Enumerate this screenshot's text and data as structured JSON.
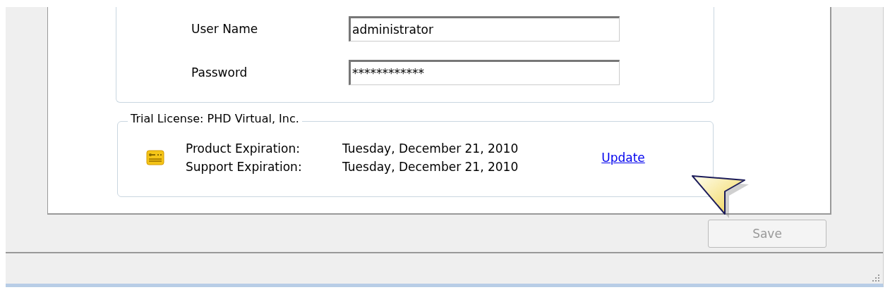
{
  "login": {
    "fields": [
      {
        "label": "User Name",
        "value": "administrator"
      },
      {
        "label": "Password",
        "value": "************"
      }
    ]
  },
  "license": {
    "title": "Trial License: PHD Virtual, Inc.",
    "rows": [
      {
        "label": "Product Expiration:",
        "value": "Tuesday, December 21, 2010"
      },
      {
        "label": "Support Expiration:",
        "value": "Tuesday, December 21, 2010"
      }
    ],
    "link": "Update"
  },
  "save_button": {
    "label": "Save",
    "disabled": true
  }
}
